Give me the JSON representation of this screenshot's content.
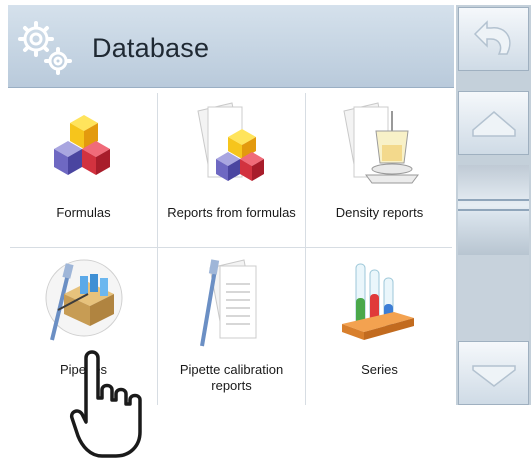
{
  "header": {
    "title": "Database",
    "icon": "gears-icon"
  },
  "tiles": [
    {
      "label": "Formulas",
      "icon": "formulas-cubes-icon"
    },
    {
      "label": "Reports from formulas",
      "icon": "formula-report-icon"
    },
    {
      "label": "Density reports",
      "icon": "density-report-icon"
    },
    {
      "label": "Pipettes",
      "icon": "pipettes-box-icon"
    },
    {
      "label": "Pipette calibration reports",
      "icon": "pipette-report-icon"
    },
    {
      "label": "Series",
      "icon": "test-tubes-icon"
    }
  ],
  "side_panel": {
    "back": "undo-icon",
    "home": "home-icon",
    "down": "arrow-down-icon"
  },
  "cursor": "hand-pointer-icon"
}
